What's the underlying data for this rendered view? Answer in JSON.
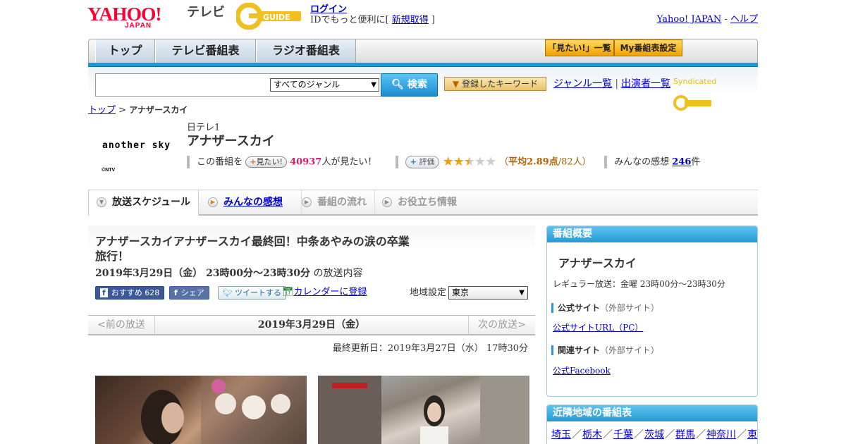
{
  "header": {
    "logo_text": "YAHOO!",
    "logo_sub": "JAPAN",
    "tv_label": "テレビ",
    "gguide_logo": "G GUIDE",
    "login_label": "ログイン",
    "login_note": "IDでもっと便利に[",
    "signup_label": "新規取得",
    "signup_close": "]",
    "yahoo_japan_link": "Yahoo! JAPAN",
    "link_sep": " - ",
    "help_link": "ヘルプ"
  },
  "nav": {
    "tabs": [
      {
        "label": "トップ"
      },
      {
        "label": "テレビ番組表"
      },
      {
        "label": "ラジオ番組表"
      }
    ],
    "want_list_label": "「見たい!」一覧",
    "my_schedule_label": "My番組表設定"
  },
  "search": {
    "input_value": "",
    "genre_selected": "すべてのジャンル",
    "search_button": "検索",
    "keyword_button": "登録したキーワード",
    "genre_list_link": "ジャンル一覧",
    "cast_list_link": "出演者一覧",
    "link_sep": "|",
    "syndicated_label": "Syndicated"
  },
  "breadcrumb": {
    "home": "トップ",
    "sep": " > ",
    "current": "アナザースカイ"
  },
  "program": {
    "logo_text": "another sky",
    "copyright": "©NTV",
    "station": "日テレ1",
    "title": "アナザースカイ",
    "want_prefix": "この番組を",
    "want_button": "見たい!",
    "want_count": "40937",
    "want_suffix": "人が見たい！",
    "rate_button": "評価",
    "rating": 2.89,
    "avg_open": "（",
    "avg_label": "平均2.89点",
    "avg_count": "/82人）",
    "impressions_label": "みんなの感想",
    "impressions_count": "246",
    "impressions_unit": "件"
  },
  "subtabs": [
    {
      "label": "放送スケジュール"
    },
    {
      "label": "みんなの感想"
    },
    {
      "label": "番組の流れ"
    },
    {
      "label": "お役立ち情報"
    }
  ],
  "episode": {
    "title": "アナザースカイアナザースカイ最終回！中条あやみの涙の卒業旅行！",
    "date": "2019年3月29日（金）",
    "time": " 23時00分～23時30分",
    "date_suffix": " の放送内容",
    "fb_recommend": "おすすめ",
    "fb_count": "628",
    "fb_share": "シェア",
    "tweet": "ツイートする",
    "calendar": "カレンダーに登録",
    "region_label": "地域設定",
    "region_value": "東京"
  },
  "pager": {
    "prev": "<前の放送",
    "current": "2019年3月29日（金）",
    "next": "次の放送>"
  },
  "updated": "最終更新日：2019年3月27日（水） 17時30分",
  "overview": {
    "heading": "番組概要",
    "title": "アナザースカイ",
    "regular": "レギュラー放送：金曜 23時00分～23時30分",
    "official_label": "公式サイト",
    "official_note": "（外部サイト）",
    "official_link": "公式サイトURL（PC）",
    "related_label": "関連サイト",
    "related_note": "（外部サイト）",
    "related_link": "公式Facebook"
  },
  "nearby": {
    "heading": "近隣地域の番組表",
    "regions": [
      "埼玉",
      "栃木",
      "千葉",
      "茨城",
      "群馬",
      "神奈川",
      "東"
    ]
  }
}
